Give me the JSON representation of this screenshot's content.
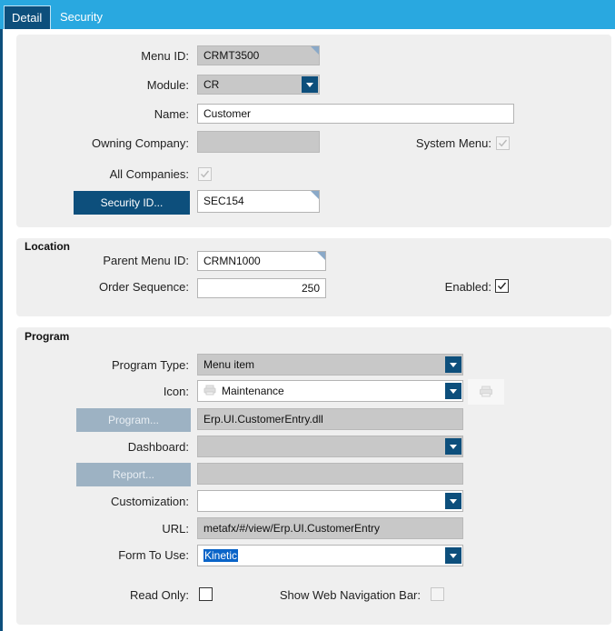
{
  "tabs": [
    {
      "label": "Detail",
      "active": true
    },
    {
      "label": "Security",
      "active": false
    }
  ],
  "detail": {
    "menu_id_label": "Menu ID:",
    "menu_id_value": "CRMT3500",
    "module_label": "Module:",
    "module_value": "CR",
    "name_label": "Name:",
    "name_value": "Customer",
    "owning_company_label": "Owning Company:",
    "owning_company_value": "",
    "system_menu_label": "System Menu:",
    "system_menu_checked": true,
    "all_companies_label": "All Companies:",
    "all_companies_checked": true,
    "security_id_button": "Security ID...",
    "security_id_value": "SEC154"
  },
  "location": {
    "title": "Location",
    "parent_menu_id_label": "Parent Menu ID:",
    "parent_menu_id_value": "CRMN1000",
    "order_sequence_label": "Order Sequence:",
    "order_sequence_value": "250",
    "enabled_label": "Enabled:",
    "enabled_checked": true
  },
  "program": {
    "title": "Program",
    "program_type_label": "Program Type:",
    "program_type_value": "Menu item",
    "icon_label": "Icon:",
    "icon_value": "Maintenance",
    "program_button": "Program...",
    "program_value": "Erp.UI.CustomerEntry.dll",
    "dashboard_label": "Dashboard:",
    "dashboard_value": "",
    "report_button": "Report...",
    "report_value": "",
    "customization_label": "Customization:",
    "customization_value": "",
    "url_label": "URL:",
    "url_value": "metafx/#/view/Erp.UI.CustomerEntry",
    "form_to_use_label": "Form To Use:",
    "form_to_use_value": "Kinetic",
    "read_only_label": "Read Only:",
    "read_only_checked": false,
    "show_web_nav_label": "Show Web Navigation Bar:",
    "show_web_nav_checked": false
  },
  "colors": {
    "tab_bar": "#29a8e0",
    "accent_dark": "#0d4f7c",
    "panel_bg": "#efefef",
    "readonly_bg": "#c8c8c8",
    "selection": "#0a64c8"
  }
}
